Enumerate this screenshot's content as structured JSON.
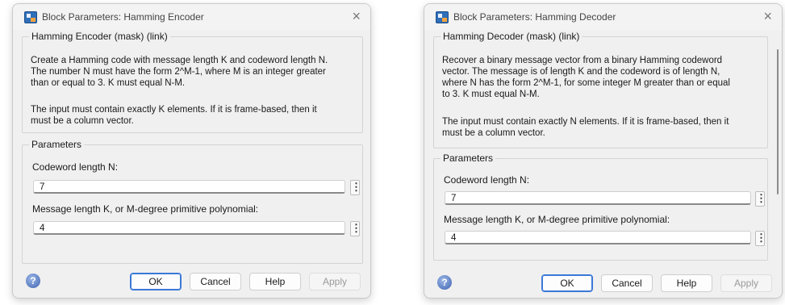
{
  "encoder": {
    "window_title": "Block Parameters: Hamming Encoder",
    "mask_title": "Hamming Encoder (mask) (link)",
    "description": [
      "Create a Hamming code with message length K and codeword length N.",
      "The number N must have the form 2^M-1, where M is an integer greater",
      "than or equal to 3.  K must equal N-M.",
      "The input must contain exactly K elements.  If it is frame-based, then it",
      "must be a column vector."
    ],
    "parameters_title": "Parameters",
    "codeword_label": "Codeword length N:",
    "codeword_value": "7",
    "message_label": "Message length K, or M-degree primitive polynomial:",
    "message_value": "4",
    "ok": "OK",
    "cancel": "Cancel",
    "help": "Help",
    "apply": "Apply"
  },
  "decoder": {
    "window_title": "Block Parameters: Hamming Decoder",
    "mask_title": "Hamming Decoder (mask) (link)",
    "description": [
      "Recover a binary message vector from a binary Hamming codeword",
      "vector.  The message is of length K and the codeword is of length N,",
      "where N has the form 2^M-1, for some integer M greater than or equal",
      "to 3.  K must equal N-M.",
      "The input must contain exactly N elements.  If it is frame-based, then it",
      "must be a column vector."
    ],
    "parameters_title": "Parameters",
    "codeword_label": "Codeword length N:",
    "codeword_value": "7",
    "message_label": "Message length K, or M-degree primitive polynomial:",
    "message_value": "4",
    "ok": "OK",
    "cancel": "Cancel",
    "help": "Help",
    "apply": "Apply"
  },
  "icons": {
    "app": "simulink-block-icon",
    "close": "×",
    "help": "?",
    "menu": "⋮"
  }
}
